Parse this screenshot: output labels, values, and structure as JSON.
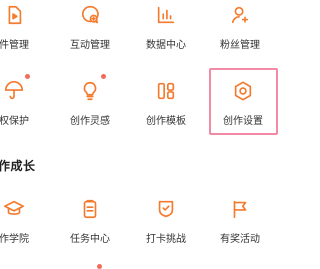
{
  "accent_color": "#f47a2e",
  "highlight_color": "#f28aa6",
  "badge_color": "#f36b5b",
  "grid_row1": [
    {
      "label": "件管理",
      "icon": "file-play-icon"
    },
    {
      "label": "互动管理",
      "icon": "comment-plus-icon"
    },
    {
      "label": "数据中心",
      "icon": "bar-chart-icon"
    },
    {
      "label": "粉丝管理",
      "icon": "user-fans-icon"
    }
  ],
  "grid_row2": [
    {
      "label": "权保护",
      "icon": "umbrella-icon",
      "has_badge": true
    },
    {
      "label": "创作灵感",
      "icon": "lightbulb-icon",
      "has_badge": true
    },
    {
      "label": "创作模板",
      "icon": "template-grid-icon",
      "has_badge": false
    },
    {
      "label": "创作设置",
      "icon": "settings-circle-icon",
      "has_badge": false,
      "highlighted": true
    }
  ],
  "section": {
    "title": "作成长"
  },
  "grid_row3": [
    {
      "label": "作学院",
      "icon": "graduation-cap-icon"
    },
    {
      "label": "任务中心",
      "icon": "task-clipboard-icon"
    },
    {
      "label": "打卡挑战",
      "icon": "shield-check-icon"
    },
    {
      "label": "有奖活动",
      "icon": "flag-icon"
    }
  ]
}
